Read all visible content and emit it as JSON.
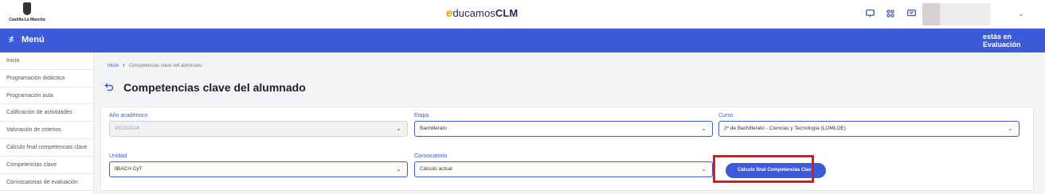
{
  "header": {
    "logo_text": "Castilla-La Mancha",
    "brand_e": "e",
    "brand_ducamos": "ducamos",
    "brand_clm": "CLM",
    "icons": [
      "monitor-icon",
      "apps-icon",
      "message-icon",
      "chevron-down-icon"
    ]
  },
  "menubar": {
    "menu_label": "Menú",
    "status_line1": "estás en",
    "status_line2": "Evaluación"
  },
  "sidebar": {
    "items": [
      {
        "label": "Inicio"
      },
      {
        "label": "Programación didáctica"
      },
      {
        "label": "Programación aula"
      },
      {
        "label": "Calificación de actividades"
      },
      {
        "label": "Valoración de criterios"
      },
      {
        "label": "Cálculo final competencias clave"
      },
      {
        "label": "Competencias clave"
      },
      {
        "label": "Convocatorias de evaluación"
      }
    ]
  },
  "breadcrumb": {
    "home": "Inicio",
    "current": "Competencias clave del alumnado"
  },
  "page": {
    "title": "Competencias clave del alumnado"
  },
  "form": {
    "anio": {
      "label": "Año académico",
      "value": "2023/2024"
    },
    "etapa": {
      "label": "Etapa",
      "value": "Bachillerato"
    },
    "curso": {
      "label": "Curso",
      "value": "2º de Bachillerato - Ciencias y Tecnología (LOMLOE)"
    },
    "unidad": {
      "label": "Unidad",
      "value": "llBACH CyT"
    },
    "convocatoria": {
      "label": "Convocatoria",
      "value": "Cálculo actual"
    },
    "calc_button": "Cálculo final Competencias Clave"
  },
  "colors": {
    "accent": "#3b5bdb",
    "highlight": "#e01818",
    "brand_e": "#e8a216"
  }
}
